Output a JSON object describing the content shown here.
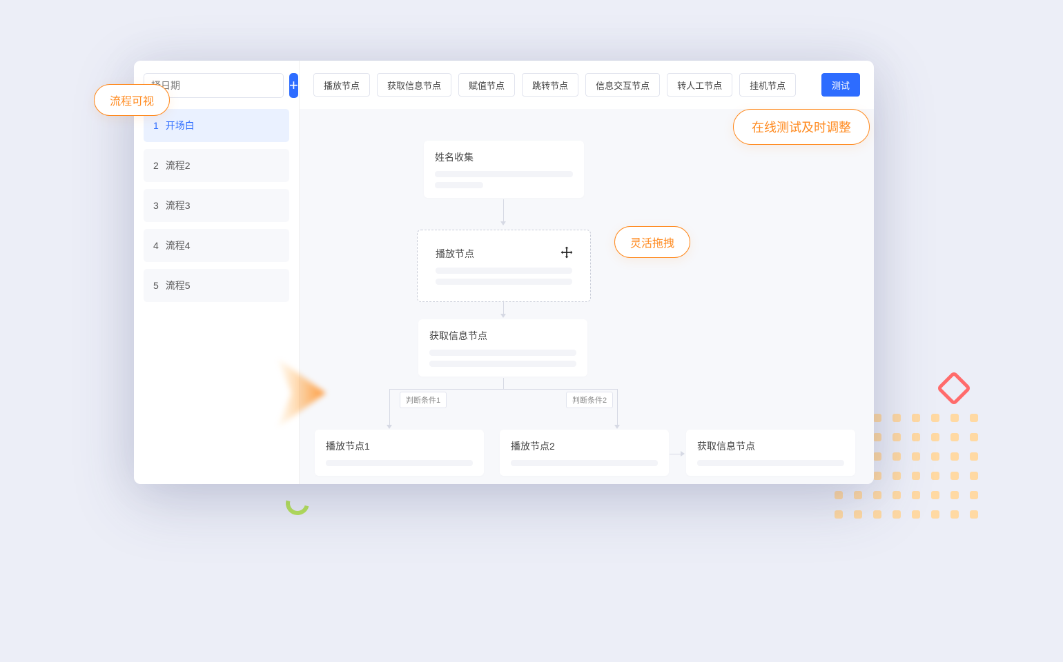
{
  "callouts": {
    "visual_flow": "流程可视",
    "online_test": "在线测试及时调整",
    "drag_drop": "灵活拖拽"
  },
  "sidebar": {
    "date_placeholder": "择日期",
    "items": [
      {
        "num": "1",
        "label": "开场白"
      },
      {
        "num": "2",
        "label": "流程2"
      },
      {
        "num": "3",
        "label": "流程3"
      },
      {
        "num": "4",
        "label": "流程4"
      },
      {
        "num": "5",
        "label": "流程5"
      }
    ]
  },
  "toolbar": {
    "buttons": [
      "播放节点",
      "获取信息节点",
      "赋值节点",
      "跳转节点",
      "信息交互节点",
      "转人工节点",
      "挂机节点"
    ],
    "test": "测试"
  },
  "flow": {
    "node_name_collect": "姓名收集",
    "node_play": "播放节点",
    "node_get_info": "获取信息节点",
    "branch1": "判断条件1",
    "branch2": "判断条件2",
    "node_play1": "播放节点1",
    "node_play2": "播放节点2",
    "node_get_info2": "获取信息节点"
  }
}
